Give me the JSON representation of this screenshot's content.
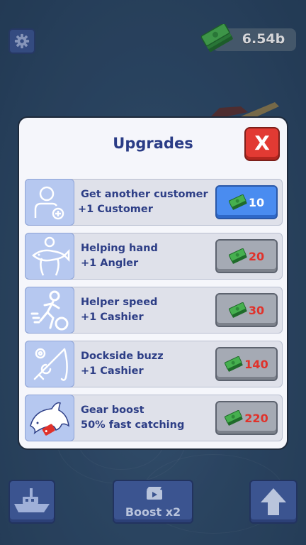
{
  "hud": {
    "money": "6.54b",
    "settings_icon": "gear-icon",
    "money_icon": "cash-stack-icon"
  },
  "upgrades": {
    "title": "Upgrades",
    "close_label": "X",
    "items": [
      {
        "title": "Get another customer",
        "subtitle": "+1 Customer",
        "price": "10",
        "icon": "add-customer-icon",
        "affordable": true
      },
      {
        "title": "Helping hand",
        "subtitle": "+1 Angler",
        "price": "20",
        "icon": "angler-fish-icon",
        "affordable": false
      },
      {
        "title": "Helper speed",
        "subtitle": "+1 Cashier",
        "price": "30",
        "icon": "running-helper-icon",
        "affordable": false
      },
      {
        "title": "Dockside buzz",
        "subtitle": "+1 Cashier",
        "price": "140",
        "icon": "fishing-rod-icon",
        "affordable": false
      },
      {
        "title": "Gear boost",
        "subtitle": "50% fast catching",
        "price": "220",
        "icon": "dolphin-tag-icon",
        "affordable": false
      }
    ]
  },
  "bottom": {
    "boost_label": "Boost x2",
    "boat_icon": "boat-icon",
    "video_icon": "video-icon",
    "upgrade_icon": "arrow-up-icon"
  },
  "colors": {
    "accent_blue": "#4a8cf0",
    "title_blue": "#2a3c86",
    "close_red": "#e23a33",
    "price_red": "#e0322b",
    "disabled_gray": "#a5aab4"
  }
}
